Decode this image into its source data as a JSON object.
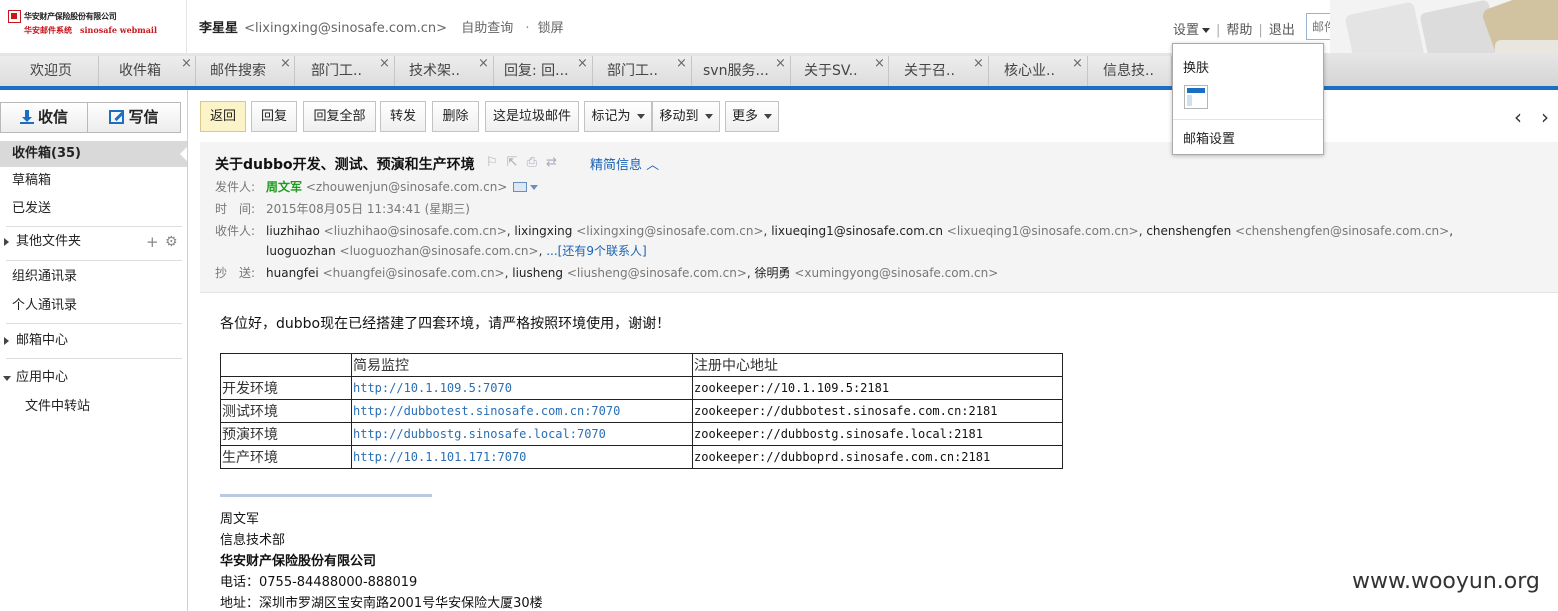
{
  "logo": {
    "company": "华安财产保险股份有限公司",
    "system": "华安邮件系统",
    "webmail": "sinosafe webmail"
  },
  "header": {
    "user_name": "李星星",
    "user_email": "<lixingxing@sinosafe.com.cn>",
    "auto_query": "自助查询",
    "lock_screen": "锁屏",
    "settings": "设置",
    "help": "帮助",
    "logout": "退出",
    "search_placeholder": "邮件全文搜索"
  },
  "tabs": [
    {
      "label": "欢迎页",
      "closable": false
    },
    {
      "label": "收件箱",
      "closable": true
    },
    {
      "label": "邮件搜索",
      "closable": true
    },
    {
      "label": "部门工..",
      "closable": true
    },
    {
      "label": "技术架..",
      "closable": true
    },
    {
      "label": "回复: 回...",
      "closable": true
    },
    {
      "label": "部门工..",
      "closable": true
    },
    {
      "label": "svn服务...",
      "closable": true
    },
    {
      "label": "关于SV..",
      "closable": true
    },
    {
      "label": "关于召..",
      "closable": true
    },
    {
      "label": "核心业..",
      "closable": true
    },
    {
      "label": "信息技..",
      "closable": false
    }
  ],
  "sidebar": {
    "inbox_btn": "收信",
    "write_btn": "写信",
    "inbox": "收件箱(35)",
    "drafts": "草稿箱",
    "sent": "已发送",
    "other_folders": "其他文件夹",
    "org_contacts": "组织通讯录",
    "personal_contacts": "个人通讯录",
    "mailbox_center": "邮箱中心",
    "app_center": "应用中心",
    "file_transfer": "文件中转站"
  },
  "toolbar": {
    "back": "返回",
    "reply": "回复",
    "reply_all": "回复全部",
    "forward": "转发",
    "delete": "删除",
    "spam": "这是垃圾邮件",
    "mark_as": "标记为",
    "move_to": "移动到",
    "more": "更多"
  },
  "pager": {
    "prev": "‹",
    "next": "›"
  },
  "message": {
    "subject": "关于dubbo开发、测试、预演和生产环境",
    "detail_toggle": "精简信息",
    "from_label": "发件人:",
    "from_name": "周文军",
    "from_addr": "<zhouwenjun@sinosafe.com.cn>",
    "time_label": "时　间:",
    "time": "2015年08月05日 11:34:41 (星期三)",
    "to_label": "收件人:",
    "to_line1": [
      {
        "name": "liuzhihao",
        "addr": "<liuzhihao@sinosafe.com.cn>"
      },
      {
        "name": "lixingxing",
        "addr": "<lixingxing@sinosafe.com.cn>"
      },
      {
        "name": "lixueqing1@sinosafe.com.cn",
        "addr": "<lixueqing1@sinosafe.com.cn>"
      },
      {
        "name": "chenshengfen",
        "addr": "<chenshengfen@sinosafe.com.cn>"
      }
    ],
    "to_line2": {
      "name": "luoguozhan",
      "addr": "<luoguozhan@sinosafe.com.cn>"
    },
    "to_more": "...[还有9个联系人]",
    "cc_label": "抄　送:",
    "cc": [
      {
        "name": "huangfei",
        "addr": "<huangfei@sinosafe.com.cn>"
      },
      {
        "name": "liusheng",
        "addr": "<liusheng@sinosafe.com.cn>"
      },
      {
        "name": "徐明勇",
        "addr": "<xumingyong@sinosafe.com.cn>"
      }
    ]
  },
  "body": {
    "greeting": "各位好，dubbo现在已经搭建了四套环境，请严格按照环境使用，谢谢！",
    "table": {
      "headers": [
        "",
        "简易监控",
        "注册中心地址"
      ],
      "rows": [
        [
          "开发环境",
          "http://10.1.109.5:7070",
          "zookeeper://10.1.109.5:2181"
        ],
        [
          "测试环境",
          "http://dubbotest.sinosafe.com.cn:7070",
          "zookeeper://dubbotest.sinosafe.com.cn:2181"
        ],
        [
          "预演环境",
          "http://dubbostg.sinosafe.local:7070",
          "zookeeper://dubbostg.sinosafe.local:2181"
        ],
        [
          "生产环境",
          "http://10.1.101.171:7070",
          "zookeeper://dubboprd.sinosafe.com.cn:2181"
        ]
      ]
    },
    "signature": {
      "name": "周文军",
      "dept": "信息技术部",
      "company": "华安财产保险股份有限公司",
      "phone": "电话：0755-84488000-888019",
      "address": "地址：深圳市罗湖区宝安南路2001号华安保险大厦30楼"
    }
  },
  "dropdown": {
    "skin": "换肤",
    "mailbox_settings": "邮箱设置"
  },
  "watermark": "www.wooyun.org",
  "colors": {
    "accent": "#1b6fc3",
    "sender": "#1e9c1e",
    "link": "#1b62b5",
    "logo_red": "#c8161d"
  }
}
